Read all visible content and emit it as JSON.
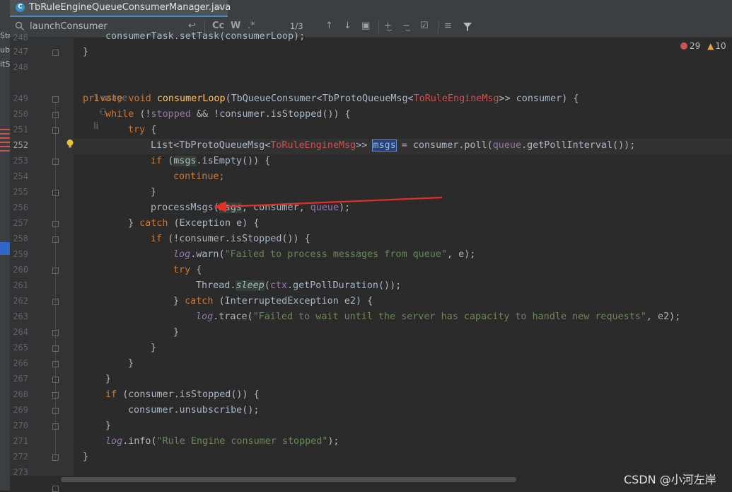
{
  "tab": {
    "title": "TbRuleEngineQueueConsumerManager.java",
    "icon_letter": "C",
    "close": "×"
  },
  "left_strip": [
    "Str",
    "ub",
    "itS"
  ],
  "search": {
    "value": "launchConsumer",
    "match_count": "1/3",
    "tools": [
      "Cc",
      "W",
      ".*"
    ]
  },
  "inspection": {
    "errors": "29",
    "warnings": "10"
  },
  "usage_hint": {
    "usages": "1 usage",
    "author": "li"
  },
  "line_numbers": [
    "246",
    "247",
    "248",
    "249",
    "250",
    "251",
    "252",
    "253",
    "254",
    "255",
    "256",
    "257",
    "258",
    "259",
    "260",
    "261",
    "262",
    "263",
    "264",
    "265",
    "266",
    "267",
    "268",
    "269",
    "270",
    "271",
    "272",
    "273"
  ],
  "code": {
    "l246": "consumerTask.setTask(consumerLoop);",
    "l247": "}",
    "l249": {
      "kw": "private void ",
      "fn": "consumerLoop",
      "a": "(TbQueueConsumer<TbProtoQueueMsg<",
      "gen": "ToRuleEngineMsg",
      "b": ">> consumer) {"
    },
    "l250": {
      "kw": "while ",
      "a": "(!",
      "fld": "stopped",
      "b": " && !consumer.isStopped()) {"
    },
    "l251": {
      "kw": "try",
      "a": " {"
    },
    "l252": {
      "a": "List<TbProtoQueueMsg<",
      "gen": "ToRuleEngineMsg",
      "b": ">> ",
      "sel": "msgs",
      "c": " = consumer.poll(",
      "fld": "queue",
      "d": ".getPollInterval());"
    },
    "l253": {
      "kw": "if ",
      "a": "(",
      "hl": "msgs",
      "b": ".isEmpty()) {"
    },
    "l254": {
      "kw": "continue",
      "a": ";"
    },
    "l255": "}",
    "l256": {
      "a": "processMsgs(",
      "hl": "msgs",
      "b": ", consumer, ",
      "fld": "queue",
      "c": ");"
    },
    "l257": {
      "a": "} ",
      "kw": "catch ",
      "b": "(Exception e) {"
    },
    "l258": {
      "kw": "if ",
      "a": "(!consumer.isStopped()) {"
    },
    "l259": {
      "it": "log",
      "a": ".warn(",
      "str": "\"Failed to process messages from queue\"",
      "b": ", e);"
    },
    "l260": {
      "kw": "try",
      "a": " {"
    },
    "l261": {
      "a": "Thread.",
      "hl": "sleep",
      "b": "(",
      "fld": "ctx",
      "c": ".getPollDuration());"
    },
    "l262": {
      "a": "} ",
      "kw": "catch ",
      "b": "(InterruptedException e2) {"
    },
    "l263": {
      "it": "log",
      "a": ".trace(",
      "str": "\"Failed to wait until the server has capacity to handle new requests\"",
      "b": ", e2);"
    },
    "l264": "}",
    "l265": "}",
    "l266": "}",
    "l267": "}",
    "l268": {
      "kw": "if ",
      "a": "(consumer.isStopped()) {"
    },
    "l269": "consumer.unsubscribe();",
    "l270": "}",
    "l271": {
      "it": "log",
      "a": ".info(",
      "str": "\"Rule Engine consumer stopped\"",
      "b": ");"
    },
    "l272": "}"
  },
  "watermark": "CSDN @小河左岸",
  "colors": {
    "background": "#2b2b2b",
    "keyword": "#cc7832",
    "method": "#ffc66d",
    "string": "#6a8759",
    "field": "#9876aa",
    "annotation_arrow": "#e0302a"
  }
}
